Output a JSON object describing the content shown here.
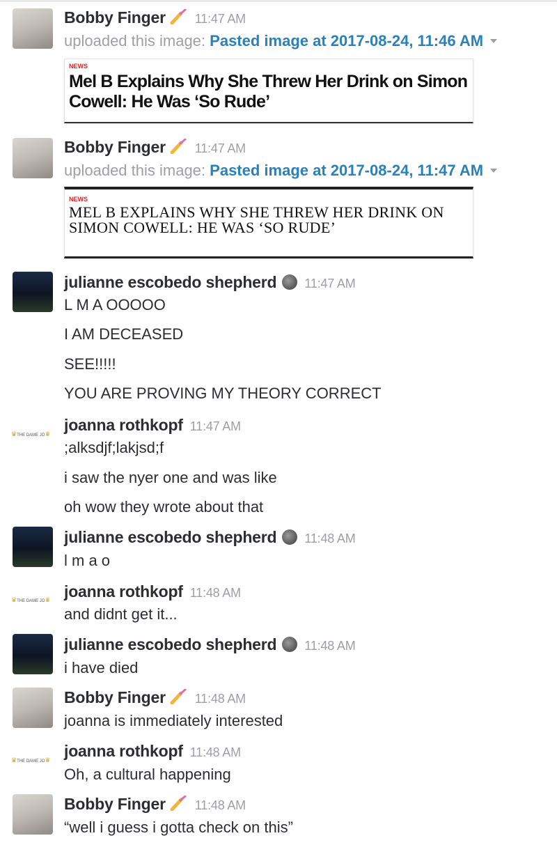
{
  "messages": [
    {
      "author": "Bobby Finger",
      "time": "11:47 AM",
      "upload_prefix": "uploaded this image:",
      "file_link": "Pasted image at 2017-08-24, 11:46 AM",
      "card": {
        "tag": "NEWS",
        "headline": "Mel B Explains Why She Threw Her Drink on Simon Cowell: He Was ‘So Rude’"
      }
    },
    {
      "author": "Bobby Finger",
      "time": "11:47 AM",
      "upload_prefix": "uploaded this image:",
      "file_link": "Pasted image at 2017-08-24, 11:47 AM",
      "card": {
        "tag": "NEWS",
        "headline": "MEL B EXPLAINS WHY SHE THREW HER DRINK ON SIMON COWELL: HE WAS ‘SO RUDE’"
      }
    },
    {
      "author": "julianne escobedo shepherd",
      "time": "11:47 AM",
      "lines": [
        "L M A OOOOO",
        "I AM DECEASED",
        "SEE!!!!!",
        "YOU ARE PROVING MY THEORY CORRECT"
      ]
    },
    {
      "author": "joanna rothkopf",
      "time": "11:47 AM",
      "avatar_text": "THE DAME JO",
      "lines": [
        ";alksdjf;lakjsd;f",
        "i saw the nyer one and was like",
        "oh wow they wrote about that"
      ]
    },
    {
      "author": "julianne escobedo shepherd",
      "time": "11:48 AM",
      "lines": [
        "l m a o"
      ]
    },
    {
      "author": "joanna rothkopf",
      "time": "11:48 AM",
      "avatar_text": "THE DAME JO",
      "lines": [
        "and didnt get it..."
      ]
    },
    {
      "author": "julianne escobedo shepherd",
      "time": "11:48 AM",
      "lines": [
        "i have died"
      ]
    },
    {
      "author": "Bobby Finger",
      "time": "11:48 AM",
      "lines": [
        "joanna is immediately interested"
      ]
    },
    {
      "author": "joanna rothkopf",
      "time": "11:48 AM",
      "avatar_text": "THE DAME JO",
      "lines": [
        "Oh, a cultural happening"
      ]
    },
    {
      "author": "Bobby Finger",
      "time": "11:48 AM",
      "lines": [
        "“well i guess i gotta check on this”"
      ]
    }
  ]
}
